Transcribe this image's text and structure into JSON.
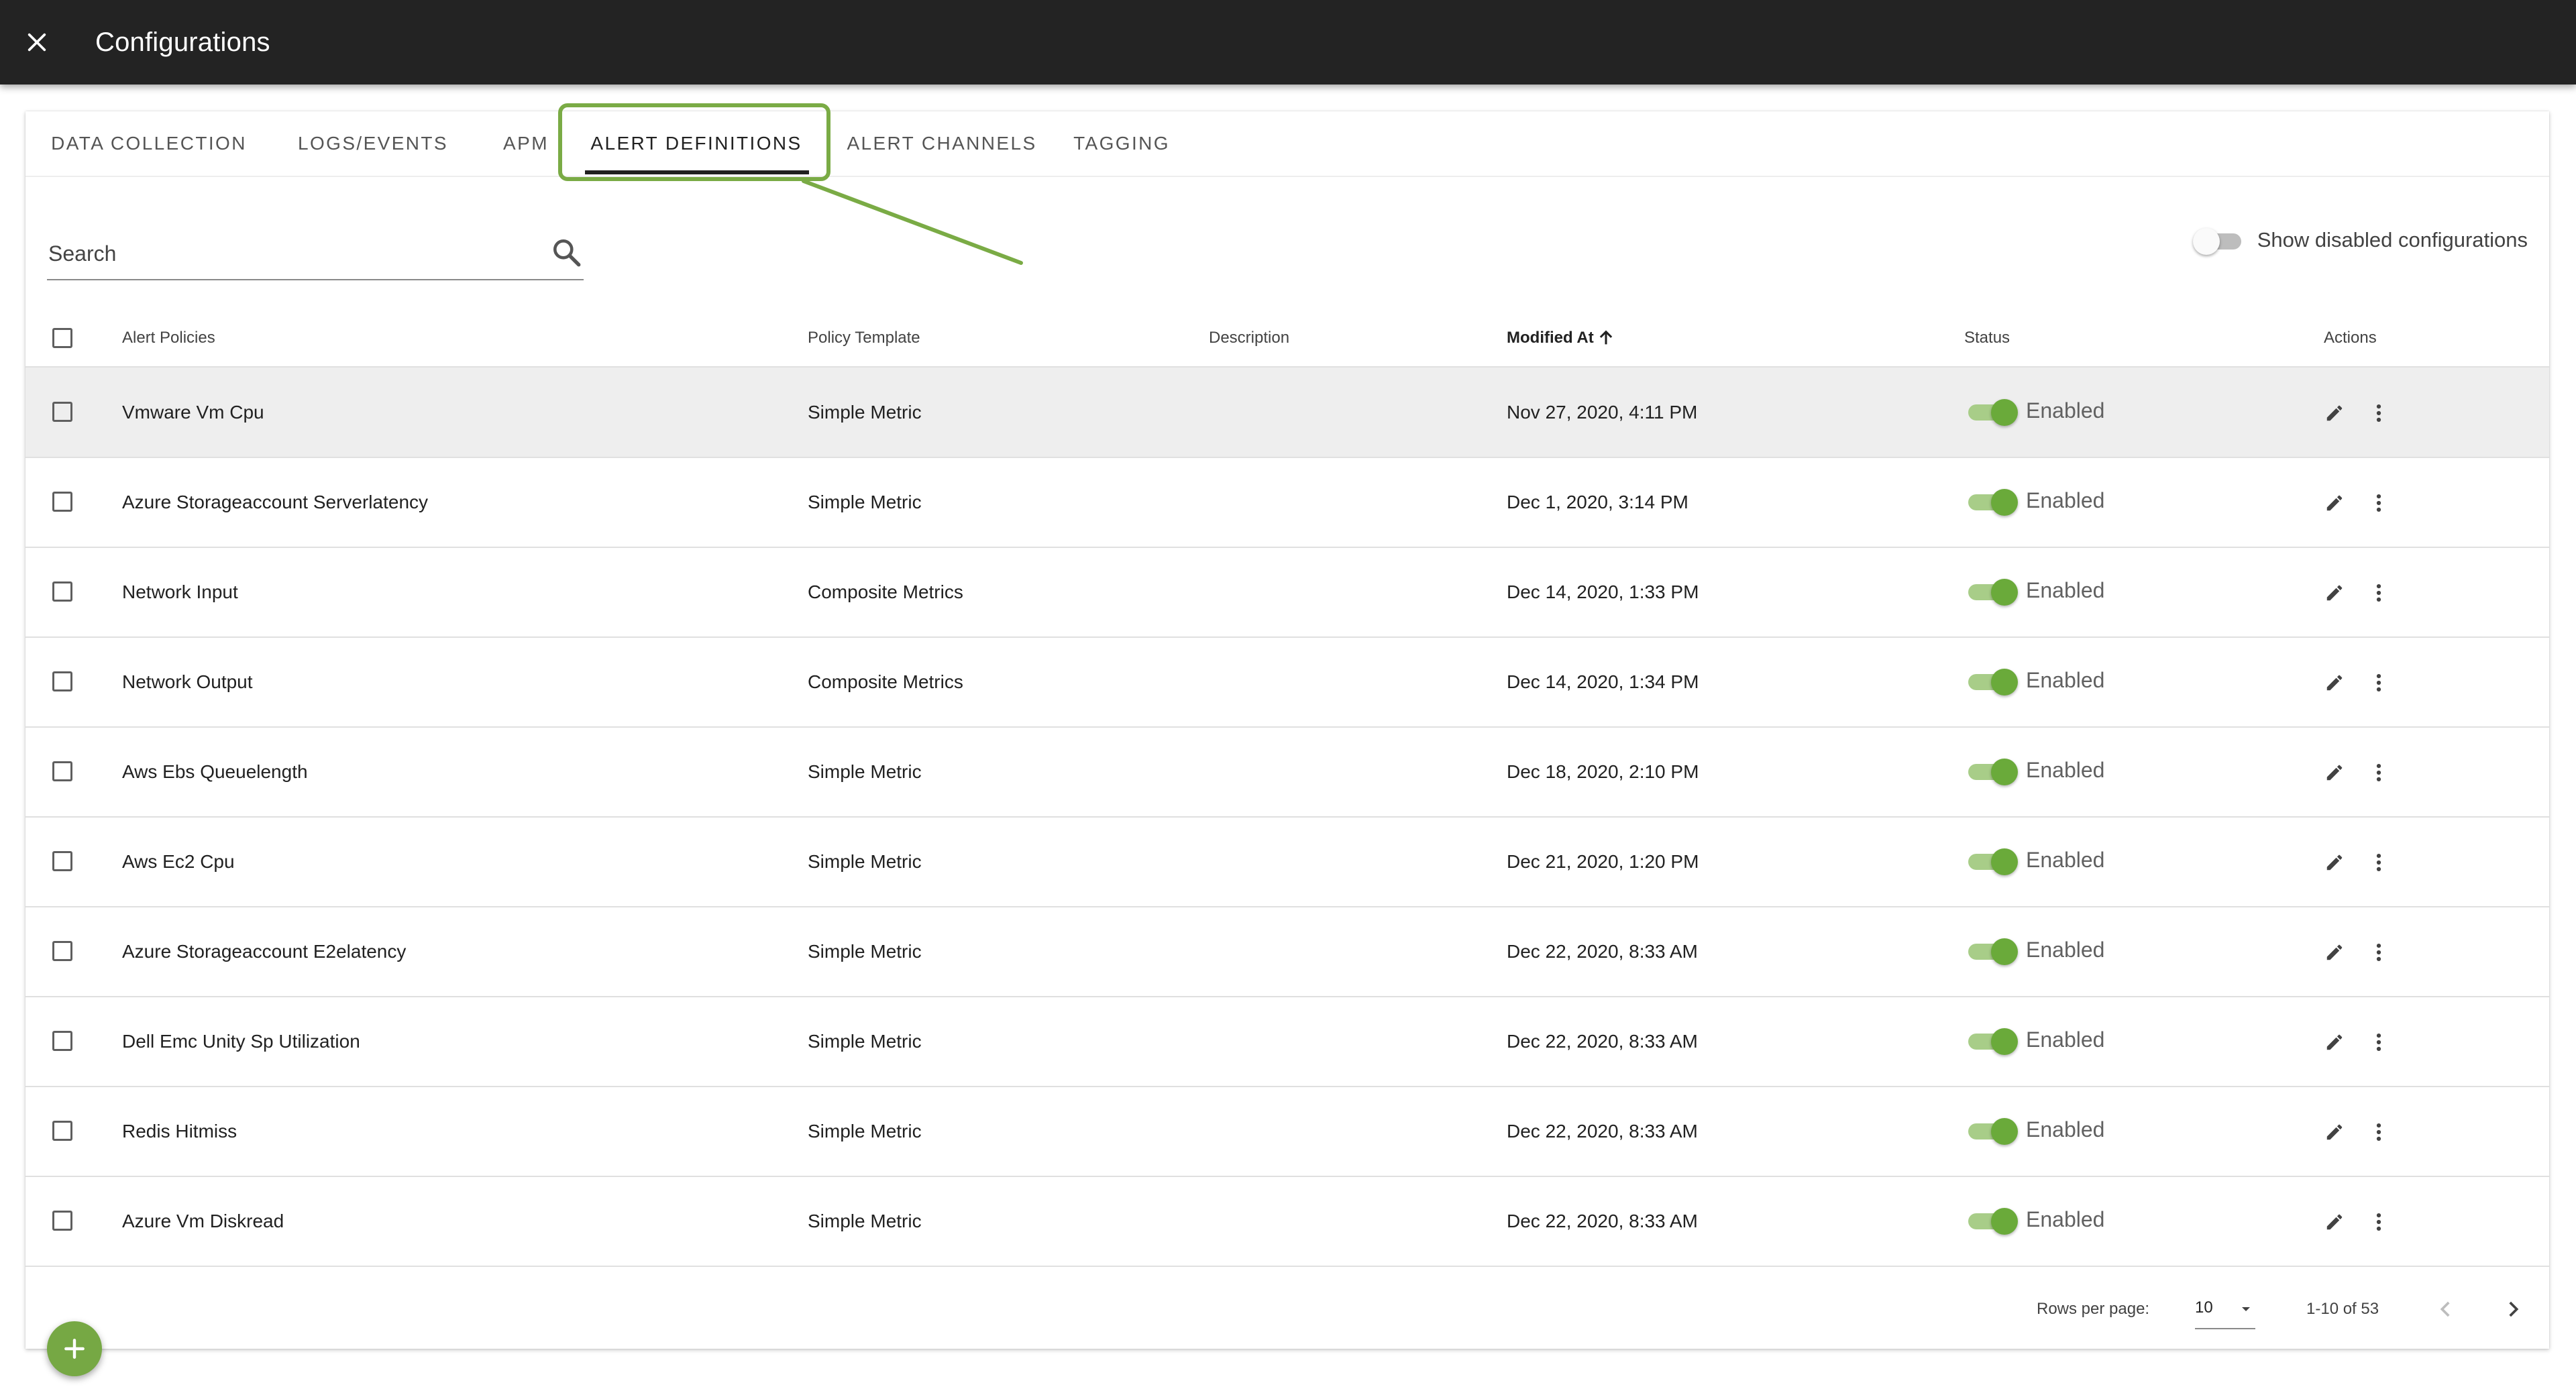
{
  "app": {
    "title": "Configurations",
    "close_icon": "close-icon"
  },
  "tabs": [
    {
      "label": "DATA COLLECTION"
    },
    {
      "label": "LOGS/EVENTS"
    },
    {
      "label": "APM"
    },
    {
      "label": "ALERT DEFINITIONS",
      "active": true
    },
    {
      "label": "ALERT CHANNELS"
    },
    {
      "label": "TAGGING"
    }
  ],
  "colors": {
    "accent": "#7aab45",
    "switch_on": "#6aaa3a",
    "appbar": "#232323"
  },
  "search": {
    "placeholder": "Search",
    "value": "",
    "icon": "search-icon"
  },
  "show_disabled": {
    "label": "Show disabled configurations",
    "on": false
  },
  "table": {
    "columns": {
      "name": "Alert Policies",
      "template": "Policy Template",
      "description": "Description",
      "modified": "Modified At",
      "status": "Status",
      "actions": "Actions"
    },
    "sort_icon": "arrow-up-icon",
    "rows": [
      {
        "name": "Vmware Vm Cpu",
        "template": "Simple Metric",
        "description": "",
        "modified": "Nov 27, 2020, 4:11 PM",
        "status": "Enabled"
      },
      {
        "name": "Azure Storageaccount Serverlatency",
        "template": "Simple Metric",
        "description": "",
        "modified": "Dec 1, 2020, 3:14 PM",
        "status": "Enabled"
      },
      {
        "name": "Network Input",
        "template": "Composite Metrics",
        "description": "",
        "modified": "Dec 14, 2020, 1:33 PM",
        "status": "Enabled"
      },
      {
        "name": "Network Output",
        "template": "Composite Metrics",
        "description": "",
        "modified": "Dec 14, 2020, 1:34 PM",
        "status": "Enabled"
      },
      {
        "name": "Aws Ebs Queuelength",
        "template": "Simple Metric",
        "description": "",
        "modified": "Dec 18, 2020, 2:10 PM",
        "status": "Enabled"
      },
      {
        "name": "Aws Ec2 Cpu",
        "template": "Simple Metric",
        "description": "",
        "modified": "Dec 21, 2020, 1:20 PM",
        "status": "Enabled"
      },
      {
        "name": "Azure Storageaccount E2elatency",
        "template": "Simple Metric",
        "description": "",
        "modified": "Dec 22, 2020, 8:33 AM",
        "status": "Enabled"
      },
      {
        "name": "Dell Emc Unity Sp Utilization",
        "template": "Simple Metric",
        "description": "",
        "modified": "Dec 22, 2020, 8:33 AM",
        "status": "Enabled"
      },
      {
        "name": "Redis Hitmiss",
        "template": "Simple Metric",
        "description": "",
        "modified": "Dec 22, 2020, 8:33 AM",
        "status": "Enabled"
      },
      {
        "name": "Azure Vm Diskread",
        "template": "Simple Metric",
        "description": "",
        "modified": "Dec 22, 2020, 8:33 AM",
        "status": "Enabled"
      }
    ]
  },
  "pagination": {
    "rows_per_page_label": "Rows per page:",
    "rows_per_page": "10",
    "range": "1-10 of 53"
  },
  "fab": {
    "icon": "plus-icon"
  }
}
